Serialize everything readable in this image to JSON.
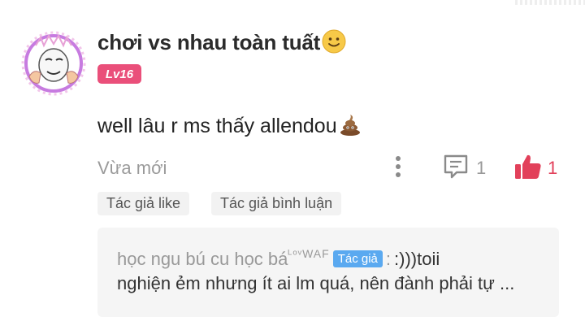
{
  "comment": {
    "author": "chơi vs nhau toàn tuất",
    "author_emoji": "slightly-smiling-face-icon",
    "level": "Lv16",
    "text": "well lâu r ms thấy allendou",
    "text_emoji": "pile-of-poo-icon",
    "timestamp": "Vừa mới",
    "reply_count": "1",
    "like_count": "1"
  },
  "tags": [
    {
      "label": "Tác giả like"
    },
    {
      "label": "Tác giả bình luận"
    }
  ],
  "reply_preview": {
    "author": "học ngu bú cu học bá",
    "author_suffix": "ᴸᵒᵛWAF",
    "author_badge": "Tác giả",
    "separator": ":",
    "text_line1": ":)))toii",
    "text_line2": "nghiện ẻm nhưng ít ai lm quá, nên đành phải tự ..."
  },
  "colors": {
    "level_badge": "#ea4f7a",
    "like_active": "#e2405a",
    "author_badge": "#5aa9f0",
    "muted_text": "#9a9a9a"
  },
  "icons": {
    "avatar": "avatar-meme-face",
    "more": "more-vertical-icon",
    "reply": "comment-reply-icon",
    "like": "thumbs-up-icon"
  }
}
